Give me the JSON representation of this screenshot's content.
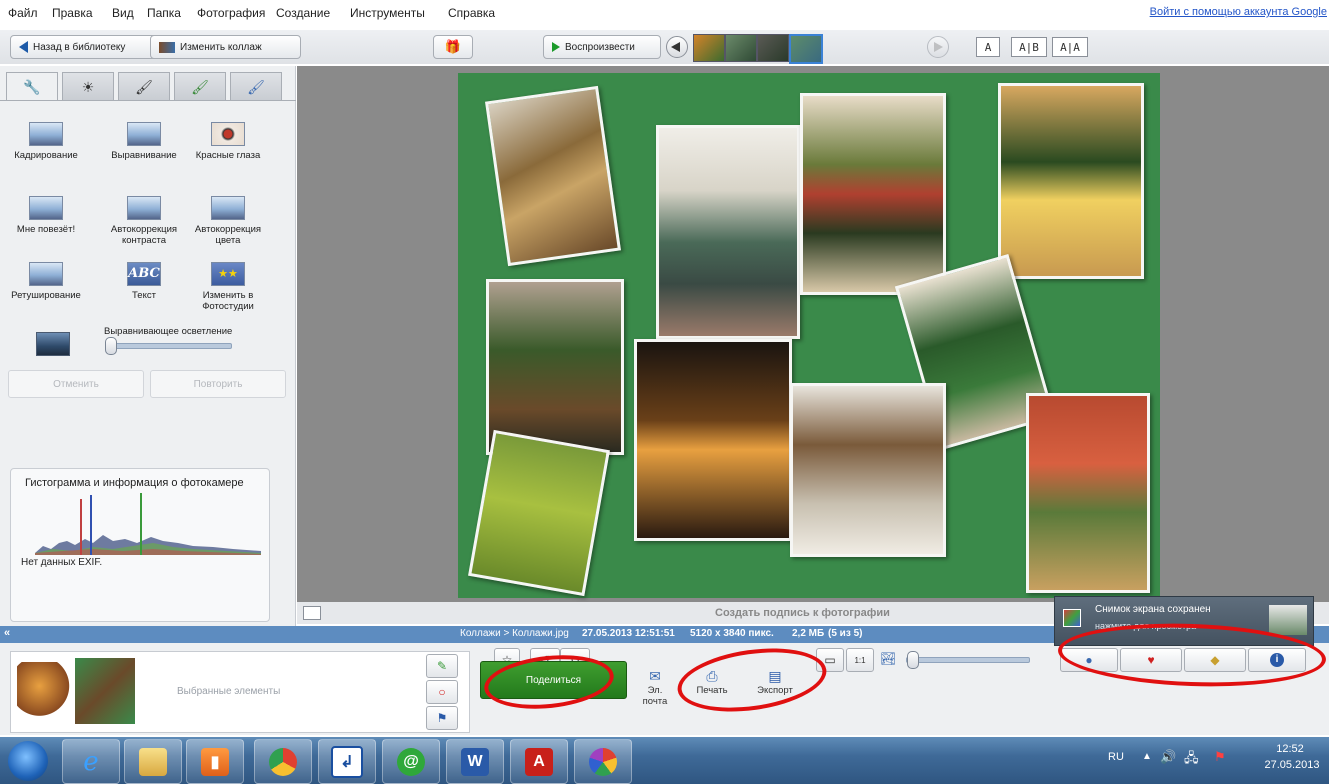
{
  "menu": [
    "Файл",
    "Правка",
    "Вид",
    "Папка",
    "Фотография",
    "Создание",
    "Инструменты",
    "Справка"
  ],
  "signin_link": "Войти с помощью аккаунта Google",
  "toolbar": {
    "back_label": "Назад в библиотеку",
    "edit_collage_label": "Изменить коллаж",
    "play_label": "Воспроизвести",
    "layout_single": "A",
    "layout_double": "A|B",
    "layout_dual": "A|A"
  },
  "tabs": [
    {
      "icon": "wrench-icon",
      "glyph": "🔧"
    },
    {
      "icon": "sun-icon",
      "glyph": "☀"
    },
    {
      "icon": "brush-icon",
      "glyph": "🖌"
    },
    {
      "icon": "brush-green-icon",
      "glyph": "🖌"
    },
    {
      "icon": "brush-blue-icon",
      "glyph": "🖌"
    }
  ],
  "tools": [
    {
      "label": "Кадрирование",
      "icon": "crop-icon",
      "style": ""
    },
    {
      "label": "Выравнивание",
      "icon": "straighten-icon",
      "style": ""
    },
    {
      "label": "Красные глаза",
      "icon": "red-eye-icon",
      "style": "eye"
    },
    {
      "label": "Мне повезёт!",
      "icon": "lucky-icon",
      "style": ""
    },
    {
      "label": "Автокоррекция контраста",
      "icon": "auto-contrast-icon",
      "style": ""
    },
    {
      "label": "Автокоррекция цвета",
      "icon": "auto-color-icon",
      "style": ""
    },
    {
      "label": "Ретуширование",
      "icon": "retouch-icon",
      "style": ""
    },
    {
      "label": "Текст",
      "icon": "text-icon",
      "style": "abc"
    },
    {
      "label": "Изменить в Фотостудии",
      "icon": "photostudio-icon",
      "style": "stars"
    }
  ],
  "fill_light": {
    "label": "Выравнивающее осветление"
  },
  "undo_label": "Отменить",
  "redo_label": "Повторить",
  "text_icon_glyph": "ABC",
  "stars_glyph": "★★",
  "histogram": {
    "title": "Гистограмма и информация о фотокамере",
    "exif": "Нет данных EXIF."
  },
  "caption_placeholder": "Создать подпись к фотографии",
  "infobar": {
    "path": "Коллажи > Коллажи.jpg",
    "date": "27.05.2013 12:51:51",
    "dims": "5120 x 3840 пикс.",
    "size": "2,2 МБ",
    "count": "(5 из 5)"
  },
  "tray_label": "Выбранные элементы",
  "share": {
    "label": "Поделиться",
    "email": "Эл. почта",
    "print": "Печать",
    "export": "Экспорт"
  },
  "zoom_label": "1:1",
  "notification": {
    "title": "Снимок экрана сохранен",
    "subtitle": "нажмите для просмотра"
  },
  "taskbar": {
    "lang": "RU",
    "time": "12:52",
    "date": "27.05.2013"
  },
  "colors": {
    "collage_bg": "#3a8a4a",
    "annotation_red": "#e01010",
    "share_green": "#2f8c24",
    "link_blue": "#2456c8"
  }
}
